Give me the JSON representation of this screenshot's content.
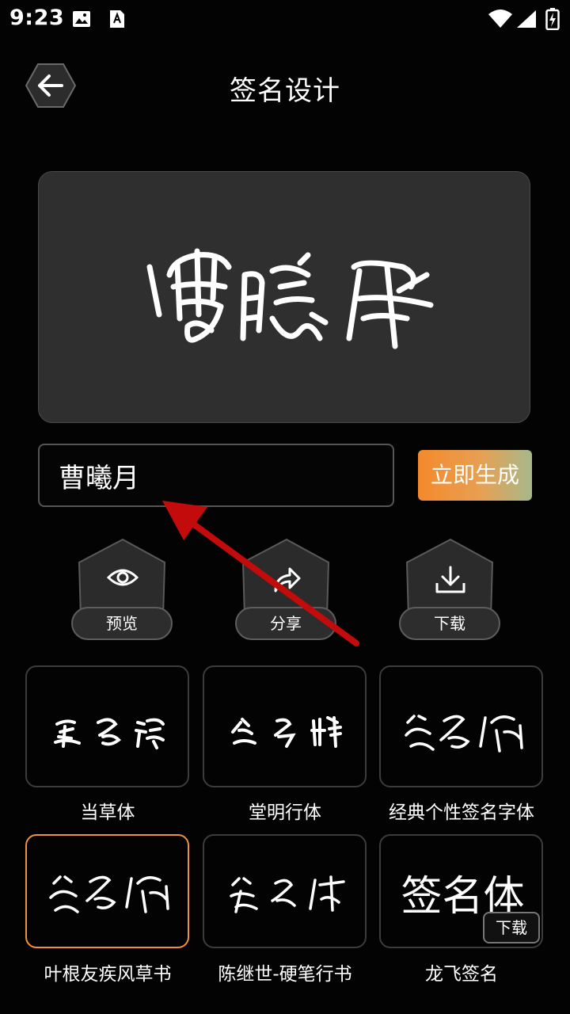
{
  "status": {
    "time": "9:23"
  },
  "header": {
    "title": "签名设计"
  },
  "preview": {
    "signature_text": "曹曦月"
  },
  "input": {
    "value": "曹曦月",
    "placeholder": ""
  },
  "generate_button": "立即生成",
  "actions": [
    {
      "label": "预览",
      "icon": "eye-icon"
    },
    {
      "label": "分享",
      "icon": "share-icon"
    },
    {
      "label": "下载",
      "icon": "download-icon"
    }
  ],
  "fonts": [
    {
      "name": "当草体",
      "sample": "签名體",
      "selected": false
    },
    {
      "name": "堂明行体",
      "sample": "签名體",
      "selected": false
    },
    {
      "name": "经典个性签名字体",
      "sample": "签名体",
      "selected": false
    },
    {
      "name": "叶根友疾风草书",
      "sample": "签名体",
      "selected": true
    },
    {
      "name": "陈继世-硬笔行书",
      "sample": "签名体",
      "selected": false
    },
    {
      "name": "龙飞签名",
      "sample": "签名体",
      "selected": false,
      "badge": "下载"
    }
  ],
  "colors": {
    "accent_orange": "#f0923c",
    "background": "#030303",
    "card": "#2f2f2f",
    "arrow": "#c30b0b"
  }
}
